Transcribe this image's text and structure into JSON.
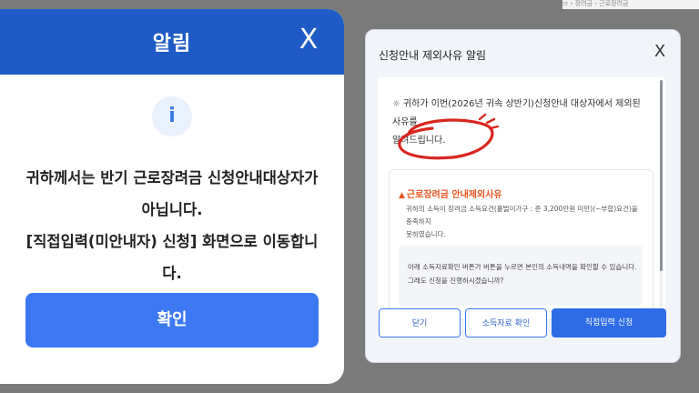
{
  "breadcrumb": "ㅁ › 장려금 › 근로장려금",
  "alert": {
    "title": "알림",
    "close_glyph": "X",
    "info_glyph": "i",
    "message_lines": [
      "귀하께서는 반기 근로장려금 신청안내대상자가",
      "아닙니다.",
      "[직접입력(미안내자) 신청] 화면으로 이동합니다."
    ],
    "confirm_label": "확인"
  },
  "dialog": {
    "title": "신청안내 제외사유 알림",
    "close_glyph": "X",
    "intro_lines": [
      "귀하가 이번(2026년 귀속 상반기)신청안내 대상자에서 제외된 사유를",
      "알려드립니다."
    ],
    "reason": {
      "title": "근로장려금 안내제외사유",
      "description_lines": [
        "귀하의 소득이 장려금 소득요건(홑벌이가구 : 준 3,200만원 미만)(~부합)요건)을 충족하지",
        "못하였습니다."
      ]
    },
    "note_lines": [
      "아래 소득자료확인 버튼가 버튼을 누르면 본인의 소득내역을 확인할 수 있습니다.",
      "그래도 신청을 진행하시겠습니까?"
    ],
    "buttons": {
      "close_label": "닫기",
      "income_check_label": "소득자료 확인",
      "direct_apply_label": "직접입력 신청"
    }
  },
  "colors": {
    "header_blue": "#1e5bc6",
    "primary_blue": "#3b78f2",
    "warning_orange": "#e8551f",
    "annotation_red": "#d8261f"
  }
}
